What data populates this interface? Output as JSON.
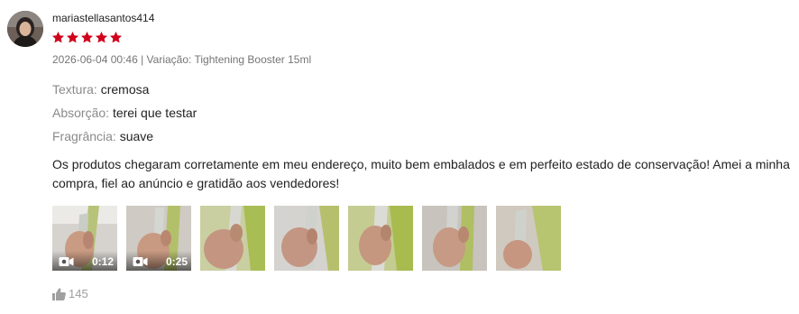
{
  "review": {
    "username": "mariastellasantos414",
    "rating": 5,
    "rating_max": 5,
    "star_color": "#d0011b",
    "date": "2026-06-04 00:46",
    "separator": " | ",
    "variation_label": "Variação:",
    "variation_value": "Tightening Booster 15ml",
    "attributes": [
      {
        "key": "Textura:",
        "value": "cremosa"
      },
      {
        "key": "Absorção:",
        "value": "terei que testar"
      },
      {
        "key": "Fragrância:",
        "value": "suave"
      }
    ],
    "comment": "Os produtos chegaram corretamente em meu endereço, muito bem embalados e em perfeito estado de conservação! Amei a minha compra, fiel ao anúncio e gratidão aos vendedores!",
    "media": [
      {
        "type": "video",
        "duration": "0:12",
        "icon": "video-camera-icon"
      },
      {
        "type": "video",
        "duration": "0:25",
        "icon": "video-camera-icon"
      },
      {
        "type": "image"
      },
      {
        "type": "image"
      },
      {
        "type": "image"
      },
      {
        "type": "image"
      },
      {
        "type": "image"
      }
    ],
    "likes": "145",
    "like_icon": "thumbs-up-icon"
  }
}
